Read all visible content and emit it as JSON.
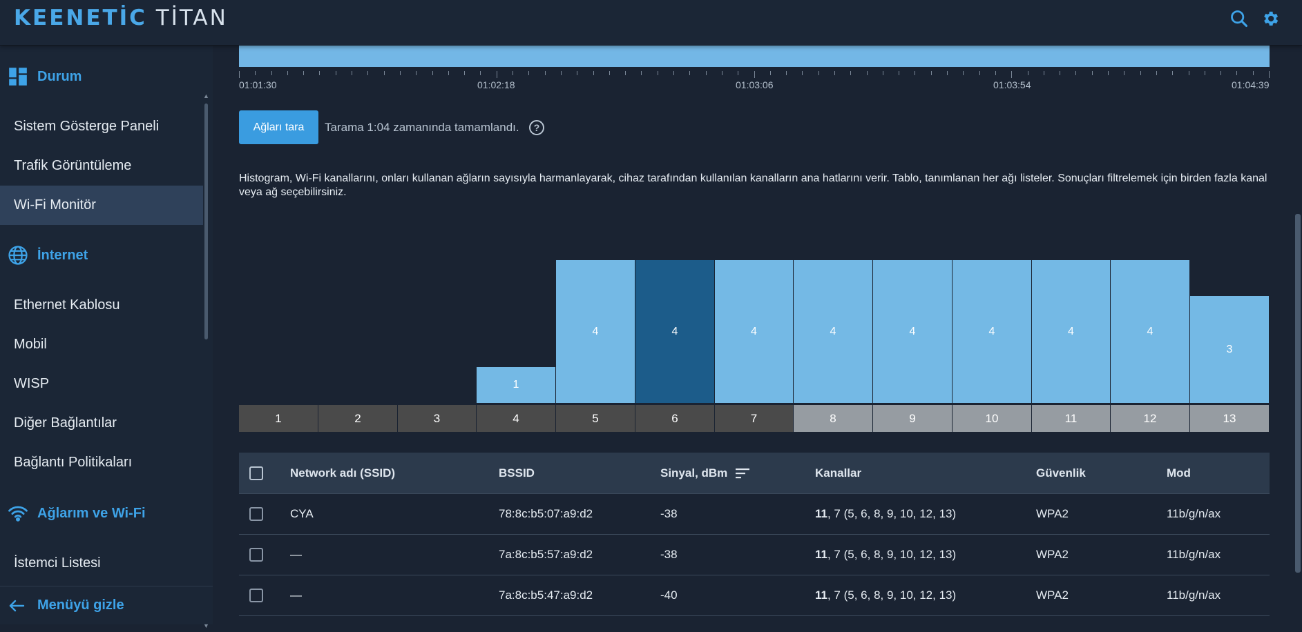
{
  "header": {
    "brand_keenetic": "KEENETİC",
    "brand_model": "TİTAN",
    "icons": [
      "search-icon",
      "gear-icon"
    ]
  },
  "sidebar": {
    "sections": [
      {
        "title": "Durum",
        "icon": "dashboard-icon"
      },
      {
        "title": "İnternet",
        "icon": "globe-icon"
      },
      {
        "title": "Ağlarım ve Wi-Fi",
        "icon": "wifi-icon"
      }
    ],
    "items": [
      {
        "label": "Sistem Gösterge Paneli"
      },
      {
        "label": "Trafik Görüntüleme"
      },
      {
        "label": "Wi-Fi Monitör",
        "active": true
      },
      {
        "label": "Ethernet Kablosu"
      },
      {
        "label": "Mobil"
      },
      {
        "label": "WISP"
      },
      {
        "label": "Diğer Bağlantılar"
      },
      {
        "label": "Bağlantı Politikaları"
      },
      {
        "label": "İstemci Listesi"
      }
    ],
    "footer": "Menüyü gizle"
  },
  "timeline": {
    "labels": [
      "01:01:30",
      "01:02:18",
      "01:03:06",
      "01:03:54",
      "01:04:39"
    ]
  },
  "scan": {
    "button": "Ağları tara",
    "status": "Tarama 1:04 zamanında tamamlandı."
  },
  "description": "Histogram, Wi-Fi kanallarını, onları kullanan ağların sayısıyla harmanlayarak, cihaz tarafından kullanılan kanalların ana hatlarını verir. Tablo, tanımlanan her ağı listeler. Sonuçları filtrelemek için birden fazla kanal veya ağ seçebilirsiniz.",
  "chart_data": {
    "type": "bar",
    "categories": [
      "1",
      "2",
      "3",
      "4",
      "5",
      "6",
      "7",
      "8",
      "9",
      "10",
      "11",
      "12",
      "13"
    ],
    "values": [
      0,
      0,
      0,
      1,
      4,
      4,
      4,
      4,
      4,
      4,
      4,
      4,
      3
    ],
    "highlighted": [
      "6"
    ],
    "ylim": [
      0,
      4
    ],
    "colors": {
      "bar": "#74b9e5",
      "bar_highlight": "#1c5c8a",
      "channel_active": "#4a4a4a",
      "channel_inactive": "#969ca2"
    }
  },
  "table": {
    "columns": [
      "Network adı (SSID)",
      "BSSID",
      "Sinyal, dBm",
      "Kanallar",
      "Güvenlik",
      "Mod"
    ],
    "rows": [
      {
        "ssid": "CYA",
        "bssid": "78:8c:b5:07:a9:d2",
        "signal": "-38",
        "channel_primary": "11",
        "channel_rest": ", 7 (5, 6, 8, 9, 10, 12, 13)",
        "security": "WPA2",
        "mode": "11b/g/n/ax"
      },
      {
        "ssid": "—",
        "bssid": "7a:8c:b5:57:a9:d2",
        "signal": "-38",
        "channel_primary": "11",
        "channel_rest": ", 7 (5, 6, 8, 9, 10, 12, 13)",
        "security": "WPA2",
        "mode": "11b/g/n/ax"
      },
      {
        "ssid": "—",
        "bssid": "7a:8c:b5:47:a9:d2",
        "signal": "-40",
        "channel_primary": "11",
        "channel_rest": ", 7 (5, 6, 8, 9, 10, 12, 13)",
        "security": "WPA2",
        "mode": "11b/g/n/ax"
      }
    ]
  }
}
